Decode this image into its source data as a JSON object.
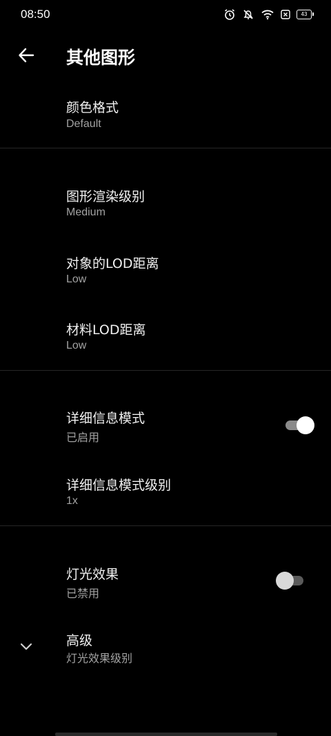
{
  "status_bar": {
    "time": "08:50",
    "battery": "43",
    "icons": [
      "alarm-icon",
      "mute-icon",
      "wifi-icon",
      "sim-off-icon",
      "battery-icon"
    ]
  },
  "app_bar": {
    "title": "其他图形",
    "back_icon": "arrow-left-icon"
  },
  "settings": {
    "color_format": {
      "title": "颜色格式",
      "value": "Default"
    },
    "render_level": {
      "title": "图形渲染级别",
      "value": "Medium"
    },
    "object_lod": {
      "title": "对象的LOD距离",
      "value": "Low"
    },
    "material_lod": {
      "title": "材料LOD距离",
      "value": "Low"
    },
    "detail_mode": {
      "title": "详细信息模式",
      "value": "已启用",
      "enabled": true
    },
    "detail_mode_level": {
      "title": "详细信息模式级别",
      "value": "1x"
    },
    "lighting": {
      "title": "灯光效果",
      "value": "已禁用",
      "enabled": false
    },
    "advanced": {
      "title": "高级",
      "value": "灯光效果级别",
      "icon": "chevron-down-icon"
    }
  },
  "colors": {
    "background": "#000000",
    "text_primary": "#f0f0f0",
    "text_secondary": "#a2a2a2",
    "divider": "#262626"
  }
}
